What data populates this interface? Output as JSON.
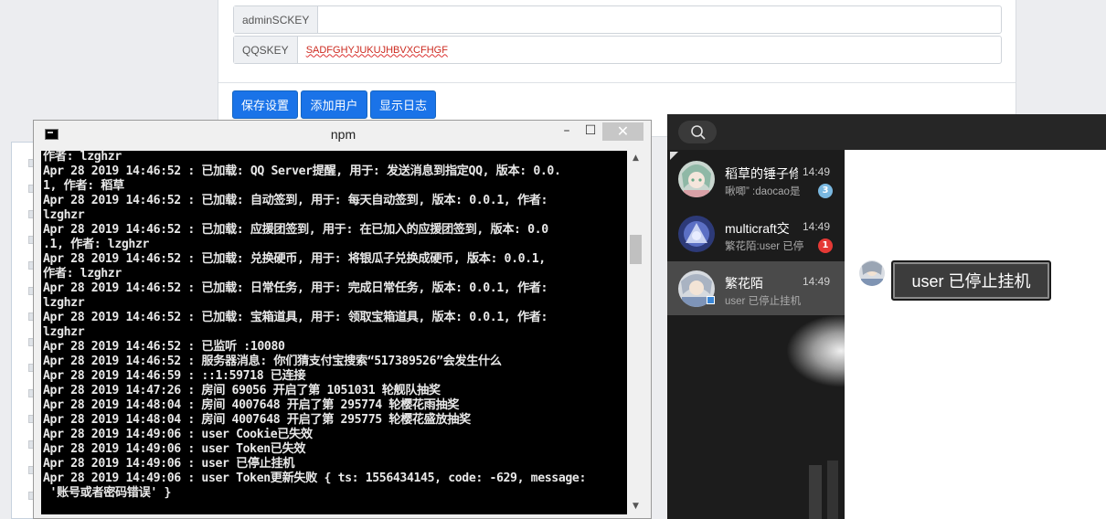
{
  "settings": {
    "rows": [
      {
        "label": "adminSCKEY",
        "value": ""
      },
      {
        "label": "QQSKEY",
        "value": "SADFGHYJUKUJHBVXCFHGF"
      }
    ],
    "buttons": {
      "save": "保存设置",
      "add_user": "添加用户",
      "show_log": "显示日志"
    }
  },
  "console": {
    "title": "npm",
    "window_controls": {
      "minimize": "–",
      "maximize": "☐",
      "close": "✕"
    },
    "lines": [
      "作者: lzghzr",
      "Apr 28 2019 14:46:52 : 已加载: QQ Server提醒, 用于: 发送消息到指定QQ, 版本: 0.0.",
      "1, 作者: 稻草",
      "Apr 28 2019 14:46:52 : 已加载: 自动签到, 用于: 每天自动签到, 版本: 0.0.1, 作者:",
      "lzghzr",
      "Apr 28 2019 14:46:52 : 已加载: 应援团签到, 用于: 在已加入的应援团签到, 版本: 0.0",
      ".1, 作者: lzghzr",
      "Apr 28 2019 14:46:52 : 已加载: 兑换硬币, 用于: 将银瓜子兑换成硬币, 版本: 0.0.1,",
      "作者: lzghzr",
      "Apr 28 2019 14:46:52 : 已加载: 日常任务, 用于: 完成日常任务, 版本: 0.0.1, 作者:",
      "lzghzr",
      "Apr 28 2019 14:46:52 : 已加载: 宝箱道具, 用于: 领取宝箱道具, 版本: 0.0.1, 作者:",
      "lzghzr",
      "Apr 28 2019 14:46:52 : 已监听 :10080",
      "Apr 28 2019 14:46:52 : 服务器消息: 你们猜支付宝搜索“517389526”会发生什么",
      "Apr 28 2019 14:46:59 : ::1:59718 已连接",
      "Apr 28 2019 14:47:26 : 房间 69056 开启了第 1051031 轮舰队抽奖",
      "Apr 28 2019 14:48:04 : 房间 4007648 开启了第 295774 轮樱花雨抽奖",
      "Apr 28 2019 14:48:04 : 房间 4007648 开启了第 295775 轮樱花盛放抽奖",
      "Apr 28 2019 14:49:06 : user Cookie已失效",
      "Apr 28 2019 14:49:06 : user Token已失效",
      "Apr 28 2019 14:49:06 : user 已停止挂机",
      "Apr 28 2019 14:49:06 : user Token更新失败 { ts: 1556434145, code: -629, message:",
      " '账号或者密码错误' }"
    ]
  },
  "chat": {
    "conversations": [
      {
        "name": "稻草的锤子修",
        "time": "14:49",
        "preview": "啾唧” :daocao是",
        "badge": "3",
        "badge_color": "#7ab8e0",
        "active": false
      },
      {
        "name": "multicraft交",
        "time": "14:49",
        "preview": "繁花陌:user 已停",
        "badge": "1",
        "badge_color": "#e53935",
        "active": false
      },
      {
        "name": "繁花陌",
        "time": "14:49",
        "preview": "user 已停止挂机",
        "badge": "",
        "badge_color": "",
        "active": true
      }
    ],
    "message": "user 已停止挂机"
  },
  "colors": {
    "accent": "#1a73e8",
    "console_bg": "#000000",
    "chat_bg": "#1d1d1d"
  }
}
